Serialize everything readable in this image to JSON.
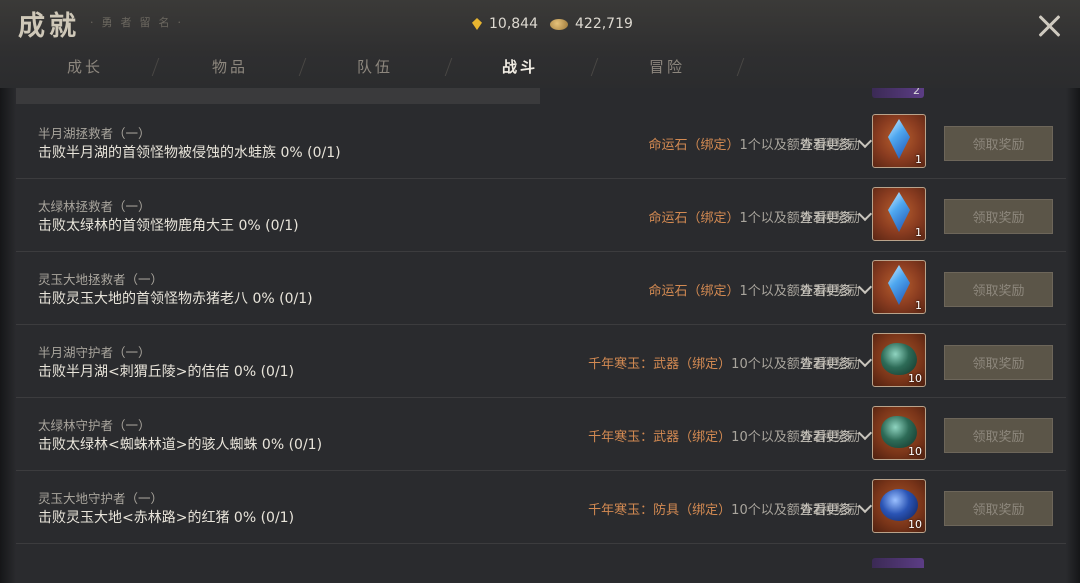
{
  "header": {
    "title": "成就",
    "subtitle": "·勇者留名·",
    "currency_gold": "10,844",
    "currency_coin": "422,719"
  },
  "tabs": [
    {
      "label": "成长",
      "active": false
    },
    {
      "label": "物品",
      "active": false
    },
    {
      "label": "队伍",
      "active": false
    },
    {
      "label": "战斗",
      "active": true
    },
    {
      "label": "冒险",
      "active": false
    }
  ],
  "stub_top_count": "2",
  "rows": [
    {
      "name": "半月湖拯救者（一）",
      "desc": "击败半月湖的首领怪物被侵蚀的水蛙族 0% (0/1)",
      "reward_name": "命运石（绑定）",
      "reward_rest": "1个以及额外3种奖励",
      "more_label": "查看更多",
      "item_icon": "crystal-icon",
      "item_count": "1",
      "claim_label": "领取奖励"
    },
    {
      "name": "太绿林拯救者（一）",
      "desc": "击败太绿林的首领怪物鹿角大王 0% (0/1)",
      "reward_name": "命运石（绑定）",
      "reward_rest": "1个以及额外3种奖励",
      "more_label": "查看更多",
      "item_icon": "crystal-icon",
      "item_count": "1",
      "claim_label": "领取奖励"
    },
    {
      "name": "灵玉大地拯救者（一）",
      "desc": "击败灵玉大地的首领怪物赤猪老八 0% (0/1)",
      "reward_name": "命运石（绑定）",
      "reward_rest": "1个以及额外3种奖励",
      "more_label": "查看更多",
      "item_icon": "crystal-icon",
      "item_count": "1",
      "claim_label": "领取奖励"
    },
    {
      "name": "半月湖守护者（一）",
      "desc": "击败半月湖<刺猬丘陵>的佶佶 0% (0/1)",
      "reward_name": "千年寒玉：武器（绑定）",
      "reward_rest": "10个以及额外2种奖励",
      "more_label": "查看更多",
      "item_icon": "jade-icon",
      "item_count": "10",
      "claim_label": "领取奖励"
    },
    {
      "name": "太绿林守护者（一）",
      "desc": "击败太绿林<蜘蛛林道>的骇人蜘蛛 0% (0/1)",
      "reward_name": "千年寒玉：武器（绑定）",
      "reward_rest": "10个以及额外2种奖励",
      "more_label": "查看更多",
      "item_icon": "jade-icon",
      "item_count": "10",
      "claim_label": "领取奖励"
    },
    {
      "name": "灵玉大地守护者（一）",
      "desc": "击败灵玉大地<赤林路>的红猪 0% (0/1)",
      "reward_name": "千年寒玉：防具（绑定）",
      "reward_rest": "10个以及额外2种奖励",
      "more_label": "查看更多",
      "item_icon": "sapphire-icon",
      "item_count": "10",
      "claim_label": "领取奖励"
    }
  ],
  "colors": {
    "reward_name": "#d38a52",
    "claim_bg": "#5b5548"
  }
}
